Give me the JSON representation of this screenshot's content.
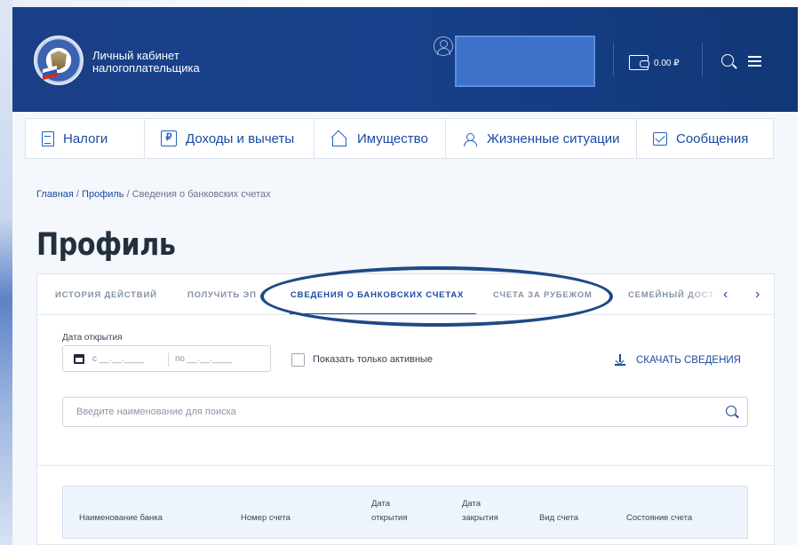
{
  "header": {
    "title_line1": "Личный кабинет",
    "title_line2": "налогоплательщика",
    "balance": "0.00 ₽"
  },
  "nav": {
    "items": [
      {
        "label": "Налоги",
        "icon": "document-icon"
      },
      {
        "label": "Доходы и вычеты",
        "icon": "ruble-icon"
      },
      {
        "label": "Имущество",
        "icon": "house-icon"
      },
      {
        "label": "Жизненные ситуации",
        "icon": "person-icon"
      },
      {
        "label": "Сообщения",
        "icon": "envelope-icon"
      }
    ]
  },
  "breadcrumb": {
    "home": "Главная",
    "sep1": " / ",
    "profile": "Профиль",
    "sep2": " / ",
    "current": "Сведения о банковских счетах"
  },
  "page_title": "Профиль",
  "tabs": [
    {
      "label": "ИСТОРИЯ ДЕЙСТВИЙ"
    },
    {
      "label": "ПОЛУЧИТЬ ЭП"
    },
    {
      "label": "СВЕДЕНИЯ О БАНКОВСКИХ СЧЕТАХ",
      "active": true
    },
    {
      "label": "СЧЕТА ЗА РУБЕЖОМ"
    },
    {
      "label": "СЕМЕЙНЫЙ ДОСТ"
    }
  ],
  "tab_arrows": {
    "prev": "‹",
    "next": "›"
  },
  "filters": {
    "date_label": "Дата открытия",
    "date_from": "с __.__.____",
    "date_to": "по __.__.____",
    "active_only_label": "Показать только активные",
    "active_only_checked": false,
    "download_label": "СКАЧАТЬ СВЕДЕНИЯ"
  },
  "search": {
    "placeholder": "Введите наименование для поиска"
  },
  "table": {
    "columns": [
      {
        "line1": "Наименование банка",
        "line2": ""
      },
      {
        "line1": "Номер счета",
        "line2": ""
      },
      {
        "line1": "Дата",
        "line2": "открытия"
      },
      {
        "line1": "Дата",
        "line2": "закрытия"
      },
      {
        "line1": "Вид счета",
        "line2": ""
      },
      {
        "line1": "Состояние счета",
        "line2": ""
      }
    ]
  },
  "colors": {
    "header_bg": "#17408a",
    "accent": "#1b4aa1",
    "highlight": "#1e4a86"
  }
}
